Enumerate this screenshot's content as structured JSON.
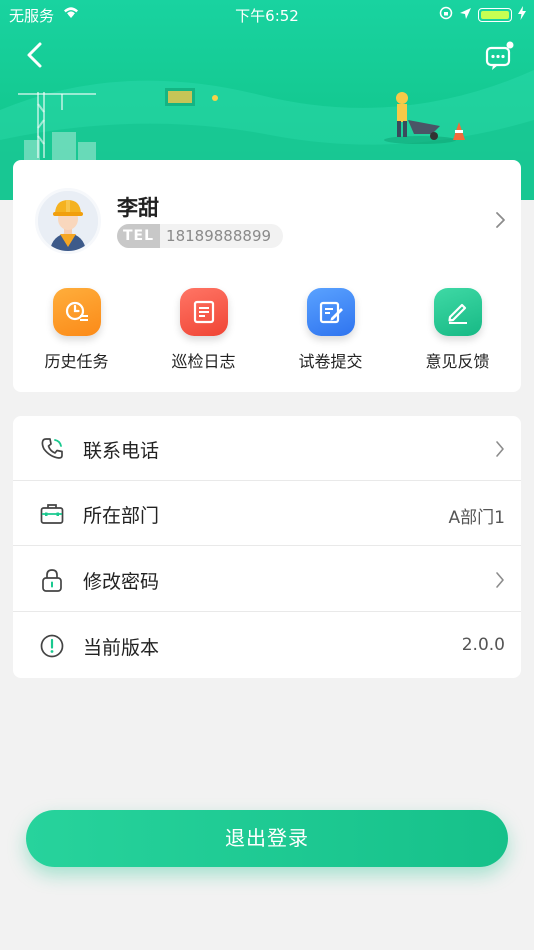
{
  "status_bar": {
    "carrier": "无服务",
    "time": "下午6:52"
  },
  "header": {
    "back_icon": "chevron-left-icon",
    "message_icon": "chat-bubble-icon"
  },
  "profile": {
    "name": "李甜",
    "tel_badge": "TEL",
    "phone": "18189888899"
  },
  "quick_actions": [
    {
      "label": "历史任务",
      "icon": "history-clock-icon",
      "color": "#fb9320"
    },
    {
      "label": "巡检日志",
      "icon": "log-document-icon",
      "color": "#f4574a"
    },
    {
      "label": "试卷提交",
      "icon": "exam-submit-icon",
      "color": "#3e87f6"
    },
    {
      "label": "意见反馈",
      "icon": "feedback-pen-icon",
      "color": "#20c48f"
    }
  ],
  "menu": {
    "phone": {
      "label": "联系电话"
    },
    "department": {
      "label": "所在部门",
      "value": "A部门1"
    },
    "password": {
      "label": "修改密码"
    },
    "version": {
      "label": "当前版本",
      "value": "2.0.0"
    }
  },
  "logout_label": "退出登录",
  "colors": {
    "primary": "#19c98f",
    "background": "#f2f2f2"
  }
}
